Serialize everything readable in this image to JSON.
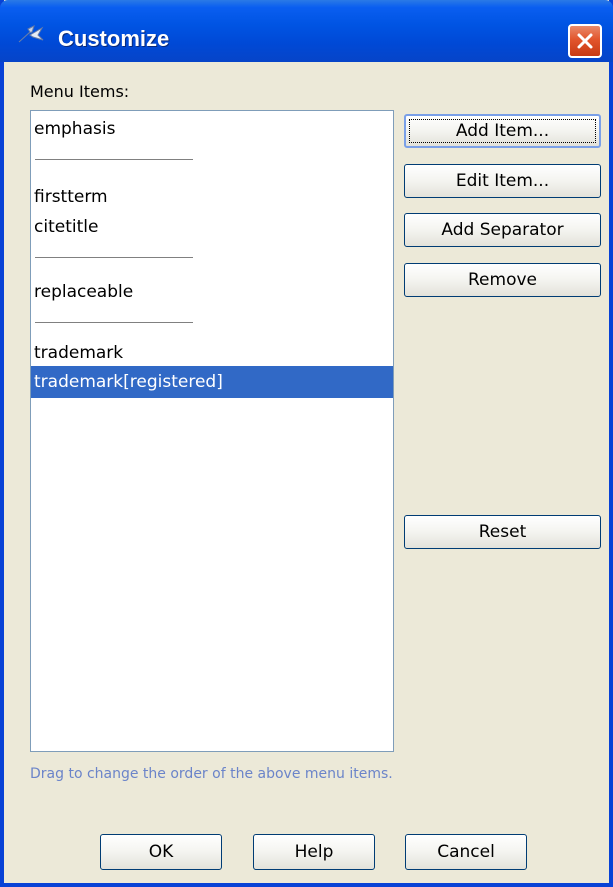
{
  "window": {
    "title": "Customize",
    "title_icon": "customize-icon",
    "close_icon": "close-icon",
    "colors": {
      "titlebar": "#0054e3",
      "close": "#e2552c",
      "selection": "#3169c6",
      "hint_text": "#6b84c9",
      "face": "#ece9d8"
    }
  },
  "menu_items_label": "Menu Items:",
  "list": {
    "items": [
      {
        "type": "item",
        "label": "emphasis"
      },
      {
        "type": "separator"
      },
      {
        "type": "item",
        "label": "firstterm"
      },
      {
        "type": "item",
        "label": "citetitle"
      },
      {
        "type": "separator"
      },
      {
        "type": "item",
        "label": "replaceable"
      },
      {
        "type": "separator"
      },
      {
        "type": "item",
        "label": "trademark"
      },
      {
        "type": "item",
        "label": "trademark[registered]",
        "selected": true
      }
    ]
  },
  "buttons": {
    "add_item": "Add Item...",
    "edit_item": "Edit Item...",
    "add_separator": "Add Separator",
    "remove": "Remove",
    "reset": "Reset"
  },
  "hint": "Drag to change the order of the above menu items.",
  "footer": {
    "ok": "OK",
    "help": "Help",
    "cancel": "Cancel"
  }
}
